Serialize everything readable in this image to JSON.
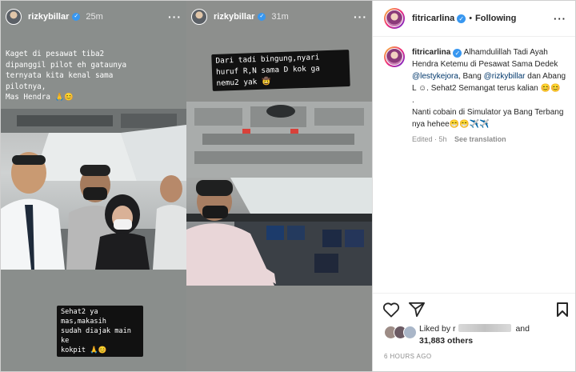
{
  "story_left": {
    "username": "rizkybillar",
    "time": "25m",
    "caption": "Kaget di pesawat tiba2\ndipanggil pilot eh gataunya\nternyata kita kenal sama\npilotnya,\nMas Hendra 🙏😊",
    "bottom_caption": "Sehat2 ya mas,makasih\nsudah diajak main ke\nkokpit 🙏😊"
  },
  "story_right": {
    "username": "rizkybillar",
    "time": "31m",
    "caption": "Dari tadi bingung,nyari\nhuruf R,N sama D kok ga\nnemu2 yak 🤠"
  },
  "post": {
    "username": "fitricarlina",
    "follow_status": "Following",
    "comment": {
      "username": "fitricarlina",
      "text_1": "Alhamdulillah Tadi Ayah Hendra Ketemu di Pesawat Sama Dedek",
      "mention_1": "@lestykejora",
      "text_2": ", Bang",
      "mention_2": "@rizkybillar",
      "text_3": "dan Abang L ☺. Sehat2 Semangat terus kalian 😊😊",
      "text_4": ".",
      "text_5": "Nanti cobain di Simulator ya Bang Terbang nya hehee😁😁✈️✈️",
      "edited": "Edited · 5h",
      "see_translation": "See translation"
    },
    "likes": {
      "prefix": "Liked by",
      "initial": "r",
      "and": "and",
      "others": "31,883 others"
    },
    "time_ago": "6 HOURS AGO"
  }
}
